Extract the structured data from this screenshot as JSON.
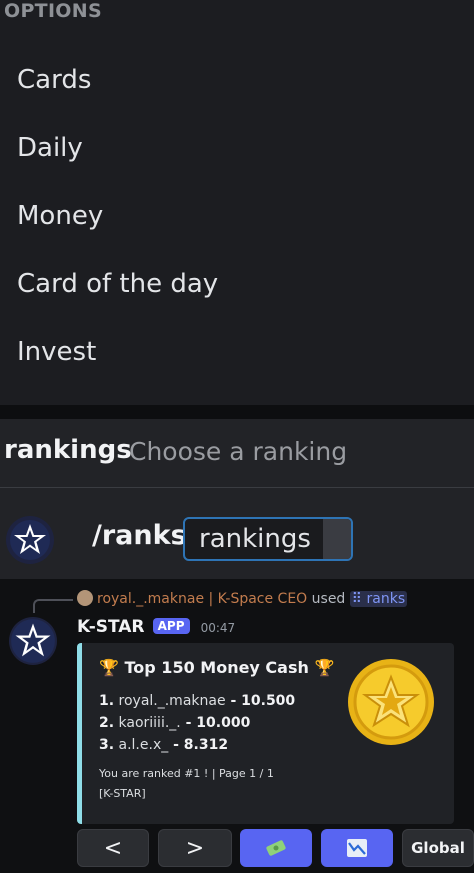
{
  "options_popup": {
    "header": "OPTIONS",
    "items": [
      "Cards",
      "Daily",
      "Money",
      "Card of the day",
      "Invest"
    ]
  },
  "command_bar": {
    "option_name": "rankings",
    "option_hint": "Choose a ranking",
    "command": "/ranks",
    "option_value": "rankings"
  },
  "message": {
    "reply": {
      "username": "royal._.maknae | K-Space CEO",
      "used_text": "used",
      "command_link": "ranks",
      "command_icon": "slash-command-icon"
    },
    "author": "K-STAR",
    "badge": "APP",
    "time": "00:47",
    "embed": {
      "accent_color": "#8fdde8",
      "title": "Top 150 Money Cash",
      "title_icon": "trophy-icon",
      "rankings": [
        {
          "rank": "1.",
          "name": "royal._.maknae",
          "value": " - 10.500"
        },
        {
          "rank": "2.",
          "name": "kaoriiii._.",
          "value": " - 10.000"
        },
        {
          "rank": "3.",
          "name": "a.l.e.x_",
          "value": " - 8.312"
        }
      ],
      "footer_line1": "You are ranked #1 ! | Page 1 / 1",
      "footer_line2": "[K-STAR]",
      "thumbnail": "gold-star-coin"
    },
    "buttons": [
      {
        "label": "<",
        "style": "grey",
        "icon": "previous-arrow"
      },
      {
        "label": ">",
        "style": "grey",
        "icon": "next-arrow"
      },
      {
        "label": "",
        "style": "blue",
        "icon": "money-icon"
      },
      {
        "label": "",
        "style": "blue",
        "icon": "chart-down-icon"
      },
      {
        "label": "Global",
        "style": "grey"
      }
    ]
  },
  "colors": {
    "accent_blue": "#5865f2",
    "username_orange": "#c27c4e",
    "focus_border": "#2e74b5"
  }
}
